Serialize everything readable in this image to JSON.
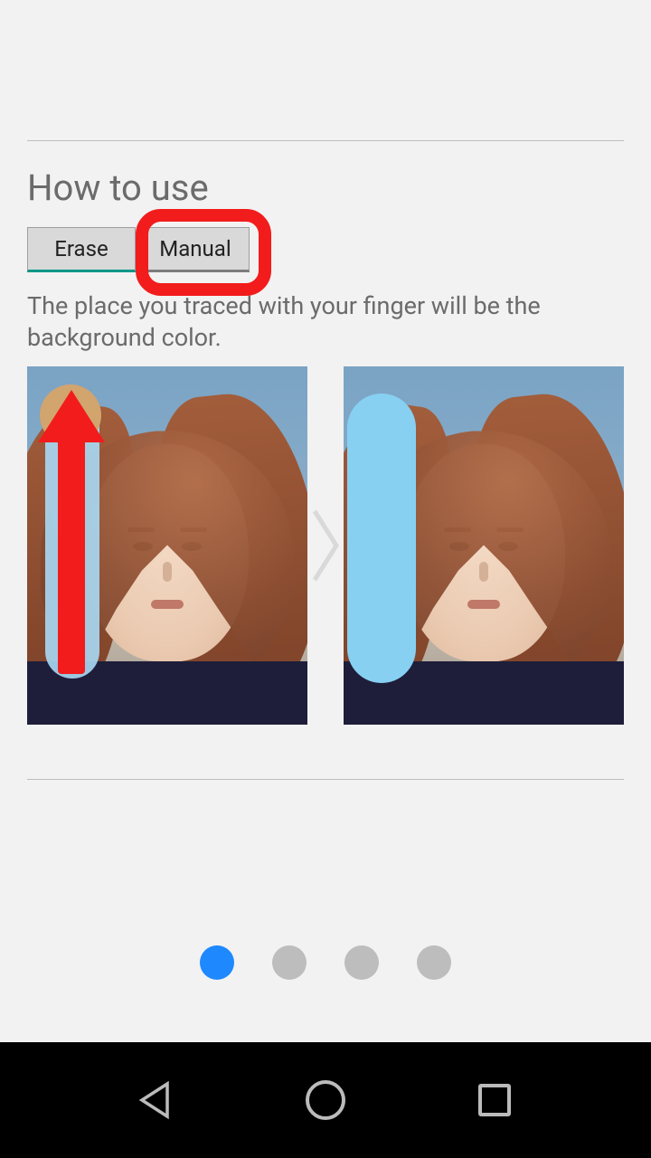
{
  "title": "How to use",
  "tabs": {
    "erase": "Erase",
    "manual": "Manual"
  },
  "description": "The place you traced with your finger will be the background color.",
  "pagination": {
    "count": 4,
    "active": 0
  }
}
